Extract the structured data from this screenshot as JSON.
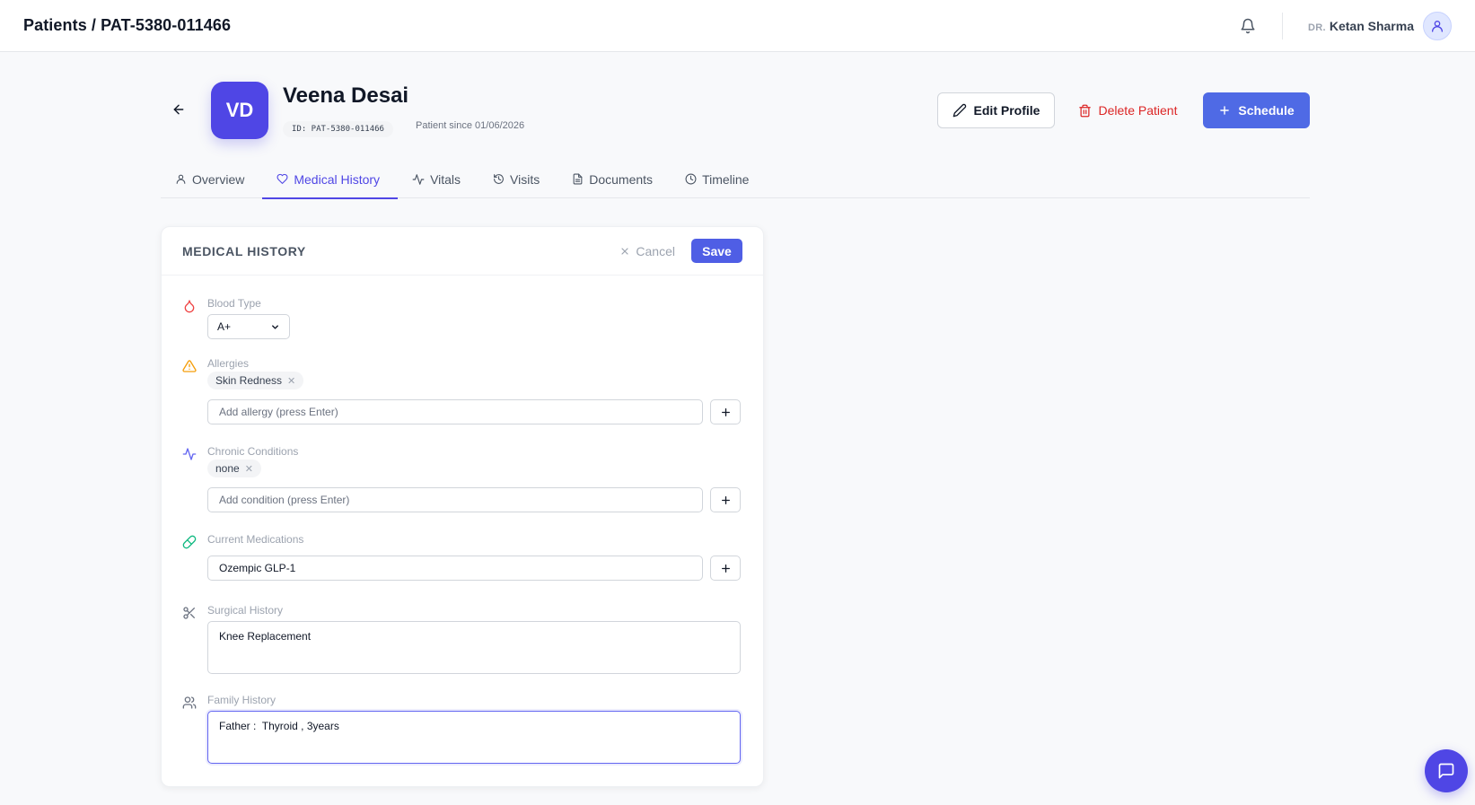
{
  "header": {
    "breadcrumb": "Patients / PAT-5380-011466",
    "doctor_prefix": "DR.",
    "doctor_name": "Ketan Sharma"
  },
  "patient": {
    "initials": "VD",
    "name": "Veena Desai",
    "id_label": "ID: PAT-5380-011466",
    "since": "Patient since 01/06/2026"
  },
  "actions": {
    "edit": "Edit Profile",
    "delete": "Delete Patient",
    "schedule": "Schedule"
  },
  "tabs": [
    {
      "label": "Overview",
      "icon": "user-icon"
    },
    {
      "label": "Medical History",
      "icon": "heart-icon",
      "active": true
    },
    {
      "label": "Vitals",
      "icon": "activity-icon"
    },
    {
      "label": "Visits",
      "icon": "history-icon"
    },
    {
      "label": "Documents",
      "icon": "document-icon"
    },
    {
      "label": "Timeline",
      "icon": "clock-icon"
    }
  ],
  "medical_history": {
    "title": "MEDICAL HISTORY",
    "cancel": "Cancel",
    "save": "Save",
    "blood_type": {
      "label": "Blood Type",
      "value": "A+"
    },
    "allergies": {
      "label": "Allergies",
      "tags": [
        "Skin Redness"
      ],
      "placeholder": "Add allergy (press Enter)"
    },
    "chronic_conditions": {
      "label": "Chronic Conditions",
      "tags": [
        "none"
      ],
      "placeholder": "Add condition (press Enter)"
    },
    "current_medications": {
      "label": "Current Medications",
      "value": "Ozempic GLP-1"
    },
    "surgical_history": {
      "label": "Surgical History",
      "value": "Knee Replacement"
    },
    "family_history": {
      "label": "Family History",
      "value": "Father :  Thyroid , 3years"
    }
  },
  "colors": {
    "accent": "#4f46e5",
    "danger": "#dc2626",
    "allergy_icon": "#f59e0b",
    "medication_icon": "#10b981",
    "blood_icon": "#ef4444"
  }
}
